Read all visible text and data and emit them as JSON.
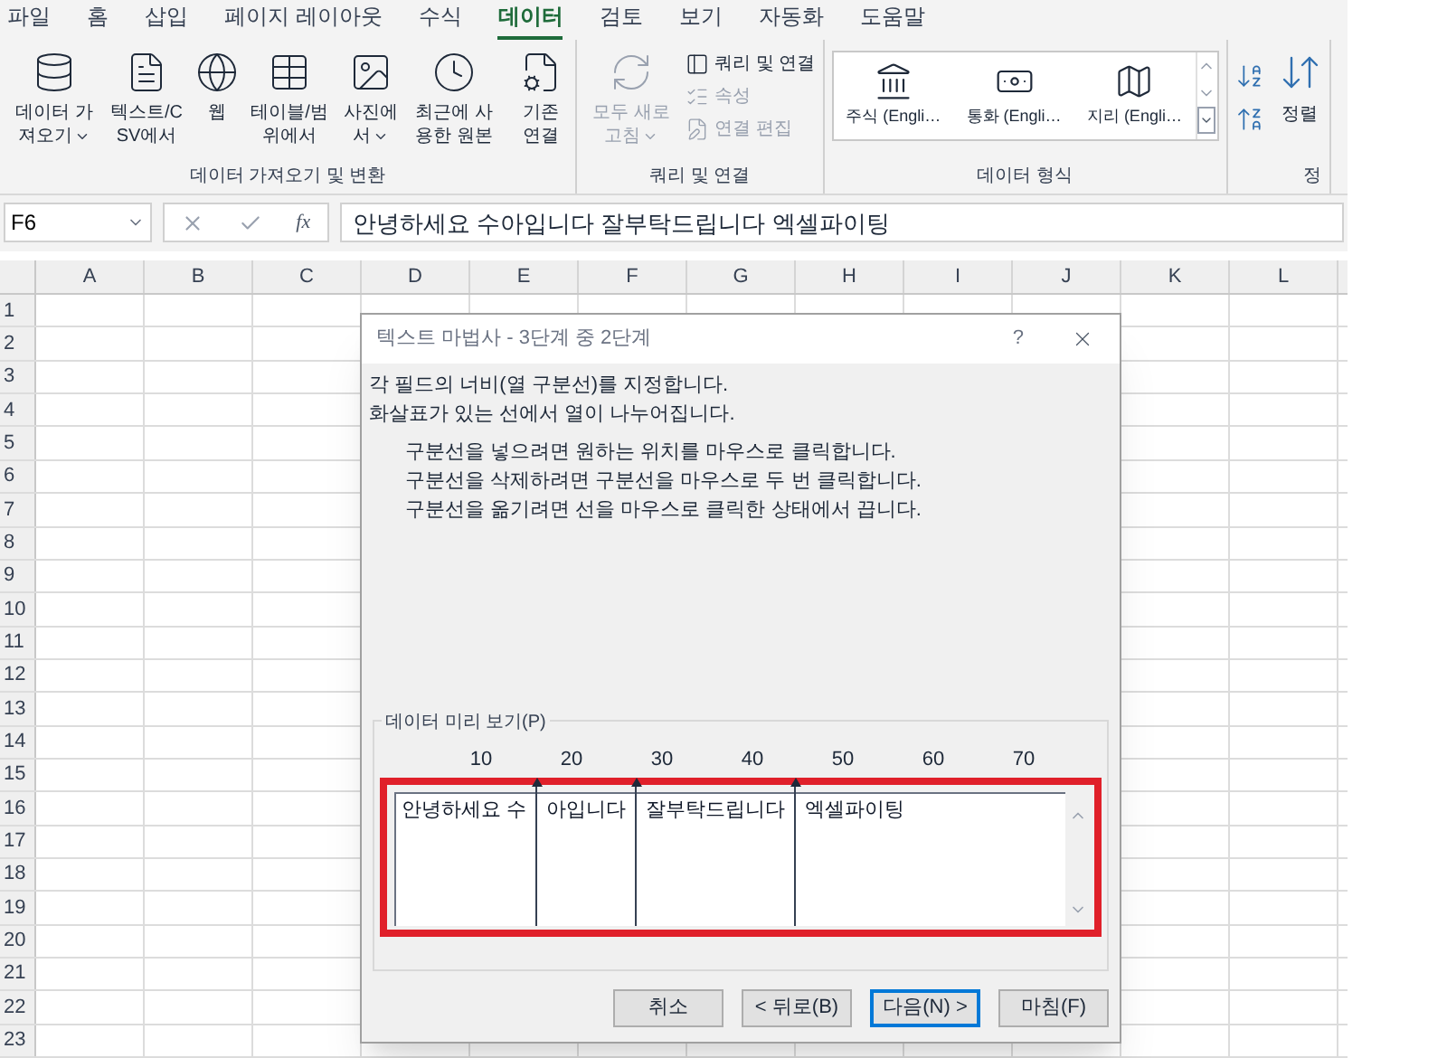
{
  "ribbon_tabs": [
    {
      "label": "파일",
      "selected": false
    },
    {
      "label": "홈",
      "selected": false
    },
    {
      "label": "삽입",
      "selected": false
    },
    {
      "label": "페이지 레이아웃",
      "selected": false
    },
    {
      "label": "수식",
      "selected": false
    },
    {
      "label": "데이터",
      "selected": true
    },
    {
      "label": "검토",
      "selected": false
    },
    {
      "label": "보기",
      "selected": false
    },
    {
      "label": "자동화",
      "selected": false
    },
    {
      "label": "도움말",
      "selected": false
    }
  ],
  "ribbon_groups": [
    {
      "kind": "large_buttons",
      "label": "데이터 가져오기 및 변환",
      "buttons": [
        {
          "label": "데이터 가져오기",
          "dropdown": true,
          "disabled": false
        },
        {
          "label": "텍스트/CSV에서",
          "disabled": false
        },
        {
          "label": "웹",
          "disabled": false
        },
        {
          "label": "테이블/범위에서",
          "disabled": false
        },
        {
          "label": "사진에서",
          "dropdown": true,
          "disabled": false
        },
        {
          "label": "최근에 사용한 원본",
          "disabled": false
        },
        {
          "label": "기존 연결",
          "disabled": false
        }
      ]
    },
    {
      "kind": "mixed",
      "label": "쿼리 및 연결",
      "buttons": [
        {
          "label": "모두 새로 고침",
          "dropdown": true,
          "disabled": true
        },
        {
          "label": "쿼리 및 연결",
          "disabled": false
        },
        {
          "label": "속성",
          "disabled": true
        },
        {
          "label": "연결 편집",
          "disabled": true
        }
      ]
    },
    {
      "kind": "gallery",
      "label": "데이터 형식",
      "buttons": [
        {
          "label": "주식 (Engli…",
          "disabled": false
        },
        {
          "label": "통화 (Engli…",
          "disabled": false
        },
        {
          "label": "지리 (Engli…",
          "disabled": false
        }
      ]
    },
    {
      "kind": "sort",
      "label": "정",
      "buttons": [
        {
          "label": "정렬",
          "disabled": false
        }
      ]
    }
  ],
  "formula_bar": {
    "name_box": "F6",
    "function_label": "fx",
    "formula": "안녕하세요 수아입니다 잘부탁드립니다 엑셀파이팅"
  },
  "sheet": {
    "columns": [
      "A",
      "B",
      "C",
      "D",
      "E",
      "F",
      "G",
      "H",
      "I",
      "J",
      "K",
      "L"
    ],
    "rows": [
      "1",
      "2",
      "3",
      "4",
      "5",
      "6",
      "7",
      "8",
      "9",
      "10",
      "11",
      "12",
      "13",
      "14",
      "15",
      "16",
      "17",
      "18",
      "19",
      "20",
      "21",
      "22",
      "23"
    ]
  },
  "dialog": {
    "title": "텍스트 마법사 - 3단계 중 2단계",
    "help": "?",
    "intro": [
      "각 필드의 너비(열 구분선)를 지정합니다.",
      "화살표가 있는 선에서 열이 나누어집니다."
    ],
    "instructions": [
      "구분선을 넣으려면 원하는 위치를 마우스로 클릭합니다.",
      "구분선을 삭제하려면 구분선을 마우스로 두 번 클릭합니다.",
      "구분선을 옮기려면 선을 마우스로 클릭한 상태에서 끕니다."
    ],
    "preview": {
      "label": "데이터 미리 보기(P)",
      "ruler": [
        "10",
        "20",
        "30",
        "40",
        "50",
        "60",
        "70"
      ],
      "fields": [
        "안녕하세요 수",
        "아입니다",
        "잘부탁드립니다",
        "엑셀파이팅"
      ]
    },
    "buttons": [
      {
        "label": "취소",
        "default": false
      },
      {
        "label": "< 뒤로(B)",
        "default": false
      },
      {
        "label": "다음(N) >",
        "default": true
      },
      {
        "label": "마침(F)",
        "default": false
      }
    ]
  }
}
